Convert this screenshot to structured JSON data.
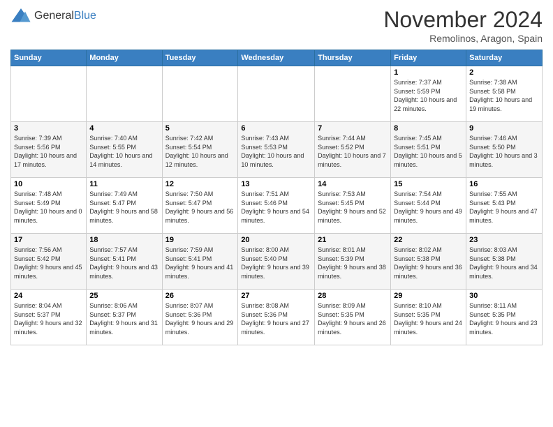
{
  "header": {
    "logo_general": "General",
    "logo_blue": "Blue",
    "month_title": "November 2024",
    "location": "Remolinos, Aragon, Spain"
  },
  "days_of_week": [
    "Sunday",
    "Monday",
    "Tuesday",
    "Wednesday",
    "Thursday",
    "Friday",
    "Saturday"
  ],
  "weeks": [
    [
      {
        "day": "",
        "info": ""
      },
      {
        "day": "",
        "info": ""
      },
      {
        "day": "",
        "info": ""
      },
      {
        "day": "",
        "info": ""
      },
      {
        "day": "",
        "info": ""
      },
      {
        "day": "1",
        "info": "Sunrise: 7:37 AM\nSunset: 5:59 PM\nDaylight: 10 hours and 22 minutes."
      },
      {
        "day": "2",
        "info": "Sunrise: 7:38 AM\nSunset: 5:58 PM\nDaylight: 10 hours and 19 minutes."
      }
    ],
    [
      {
        "day": "3",
        "info": "Sunrise: 7:39 AM\nSunset: 5:56 PM\nDaylight: 10 hours and 17 minutes."
      },
      {
        "day": "4",
        "info": "Sunrise: 7:40 AM\nSunset: 5:55 PM\nDaylight: 10 hours and 14 minutes."
      },
      {
        "day": "5",
        "info": "Sunrise: 7:42 AM\nSunset: 5:54 PM\nDaylight: 10 hours and 12 minutes."
      },
      {
        "day": "6",
        "info": "Sunrise: 7:43 AM\nSunset: 5:53 PM\nDaylight: 10 hours and 10 minutes."
      },
      {
        "day": "7",
        "info": "Sunrise: 7:44 AM\nSunset: 5:52 PM\nDaylight: 10 hours and 7 minutes."
      },
      {
        "day": "8",
        "info": "Sunrise: 7:45 AM\nSunset: 5:51 PM\nDaylight: 10 hours and 5 minutes."
      },
      {
        "day": "9",
        "info": "Sunrise: 7:46 AM\nSunset: 5:50 PM\nDaylight: 10 hours and 3 minutes."
      }
    ],
    [
      {
        "day": "10",
        "info": "Sunrise: 7:48 AM\nSunset: 5:49 PM\nDaylight: 10 hours and 0 minutes."
      },
      {
        "day": "11",
        "info": "Sunrise: 7:49 AM\nSunset: 5:47 PM\nDaylight: 9 hours and 58 minutes."
      },
      {
        "day": "12",
        "info": "Sunrise: 7:50 AM\nSunset: 5:47 PM\nDaylight: 9 hours and 56 minutes."
      },
      {
        "day": "13",
        "info": "Sunrise: 7:51 AM\nSunset: 5:46 PM\nDaylight: 9 hours and 54 minutes."
      },
      {
        "day": "14",
        "info": "Sunrise: 7:53 AM\nSunset: 5:45 PM\nDaylight: 9 hours and 52 minutes."
      },
      {
        "day": "15",
        "info": "Sunrise: 7:54 AM\nSunset: 5:44 PM\nDaylight: 9 hours and 49 minutes."
      },
      {
        "day": "16",
        "info": "Sunrise: 7:55 AM\nSunset: 5:43 PM\nDaylight: 9 hours and 47 minutes."
      }
    ],
    [
      {
        "day": "17",
        "info": "Sunrise: 7:56 AM\nSunset: 5:42 PM\nDaylight: 9 hours and 45 minutes."
      },
      {
        "day": "18",
        "info": "Sunrise: 7:57 AM\nSunset: 5:41 PM\nDaylight: 9 hours and 43 minutes."
      },
      {
        "day": "19",
        "info": "Sunrise: 7:59 AM\nSunset: 5:41 PM\nDaylight: 9 hours and 41 minutes."
      },
      {
        "day": "20",
        "info": "Sunrise: 8:00 AM\nSunset: 5:40 PM\nDaylight: 9 hours and 39 minutes."
      },
      {
        "day": "21",
        "info": "Sunrise: 8:01 AM\nSunset: 5:39 PM\nDaylight: 9 hours and 38 minutes."
      },
      {
        "day": "22",
        "info": "Sunrise: 8:02 AM\nSunset: 5:38 PM\nDaylight: 9 hours and 36 minutes."
      },
      {
        "day": "23",
        "info": "Sunrise: 8:03 AM\nSunset: 5:38 PM\nDaylight: 9 hours and 34 minutes."
      }
    ],
    [
      {
        "day": "24",
        "info": "Sunrise: 8:04 AM\nSunset: 5:37 PM\nDaylight: 9 hours and 32 minutes."
      },
      {
        "day": "25",
        "info": "Sunrise: 8:06 AM\nSunset: 5:37 PM\nDaylight: 9 hours and 31 minutes."
      },
      {
        "day": "26",
        "info": "Sunrise: 8:07 AM\nSunset: 5:36 PM\nDaylight: 9 hours and 29 minutes."
      },
      {
        "day": "27",
        "info": "Sunrise: 8:08 AM\nSunset: 5:36 PM\nDaylight: 9 hours and 27 minutes."
      },
      {
        "day": "28",
        "info": "Sunrise: 8:09 AM\nSunset: 5:35 PM\nDaylight: 9 hours and 26 minutes."
      },
      {
        "day": "29",
        "info": "Sunrise: 8:10 AM\nSunset: 5:35 PM\nDaylight: 9 hours and 24 minutes."
      },
      {
        "day": "30",
        "info": "Sunrise: 8:11 AM\nSunset: 5:35 PM\nDaylight: 9 hours and 23 minutes."
      }
    ]
  ]
}
